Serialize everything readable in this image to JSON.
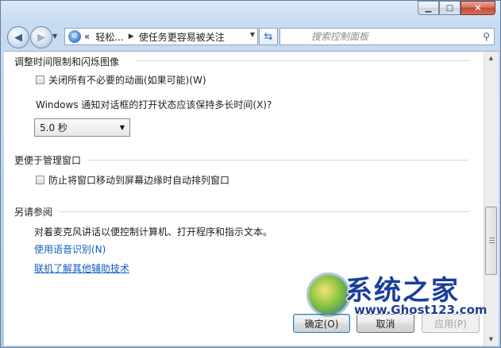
{
  "window": {
    "controls": {
      "minimize_icon": "minimize-icon",
      "maximize_icon": "maximize-icon",
      "close_icon": "close-icon"
    }
  },
  "navbar": {
    "back_icon": "back-arrow-icon",
    "forward_icon": "forward-arrow-icon",
    "address": {
      "overflow_chevron": "«",
      "crumbs": [
        "轻松...",
        "使任务更容易被关注"
      ]
    },
    "search_placeholder": "搜索控制面板"
  },
  "content": {
    "section_flash": {
      "title": "调整时间限制和闪烁图像",
      "checkbox_label": "关闭所有不必要的动画(如果可能)(W)",
      "checkbox_checked": false,
      "notify_question": "Windows 通知对话框的打开状态应该保持多长时间(X)?",
      "duration_selected": "5.0 秒"
    },
    "section_windows": {
      "title": "更便于管理窗口",
      "checkbox_label": "防止将窗口移动到屏幕边缘时自动排列窗口",
      "checkbox_checked": false
    },
    "section_see_also": {
      "title": "另请参阅",
      "description": "对着麦克风讲话以便控制计算机、打开程序和指示文本。",
      "link_speech": "使用语音识别(N)",
      "link_online": "联机了解其他辅助技术"
    }
  },
  "buttons": {
    "ok": "确定(O)",
    "cancel": "取消",
    "apply": "应用(P)"
  },
  "watermark": {
    "name": "系统之家",
    "url": "www.Ghost123.com"
  }
}
